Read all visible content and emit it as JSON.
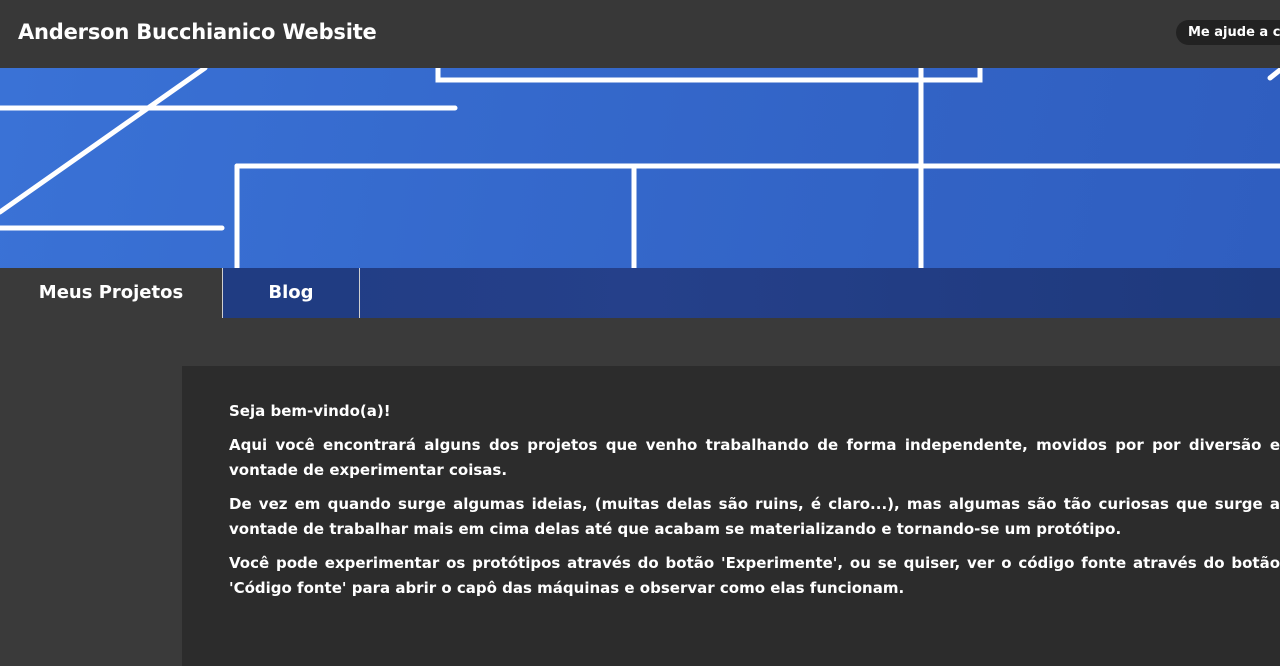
{
  "header": {
    "site_title": "Anderson Bucchianico Website",
    "help_button_label": "Me ajude a con"
  },
  "banner": {
    "accent_color": "#3a72d6"
  },
  "nav": {
    "tabs": [
      {
        "label": "Meus Projetos",
        "active": true
      },
      {
        "label": "Blog",
        "active": false
      }
    ]
  },
  "main": {
    "greeting": "Seja bem-vindo(a)!",
    "paragraphs": [
      "Aqui você encontrará alguns dos projetos que venho trabalhando de forma independente, movidos por por diversão e vontade de experimentar coisas.",
      "De vez em quando surge algumas ideias, (muitas delas são ruins, é claro...), mas algumas são tão curiosas que surge a vontade de trabalhar mais em cima delas até que acabam se materializando e tornando-se um protótipo.",
      "Você pode experimentar os protótipos através do botão 'Experimente', ou se quiser, ver o código fonte através do botão 'Código fonte' para abrir o capô das máquinas e observar como elas funcionam."
    ]
  }
}
